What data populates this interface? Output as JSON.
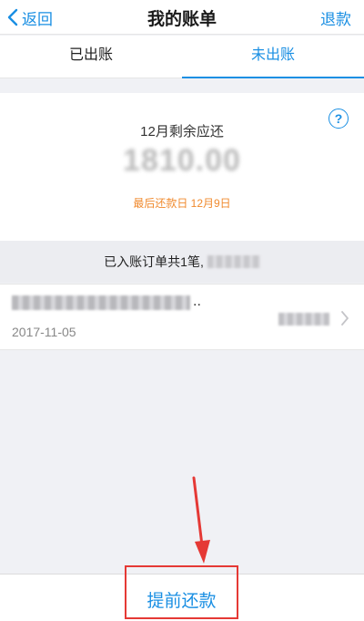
{
  "nav": {
    "back_label": "返回",
    "title": "我的账单",
    "right_label": "退款"
  },
  "tabs": [
    {
      "label": "已出账",
      "active": false
    },
    {
      "label": "未出账",
      "active": true
    }
  ],
  "summary": {
    "label": "12月剩余应还",
    "amount": "1810.00",
    "due_text": "最后还款日 12月9日",
    "help_icon": "?"
  },
  "orders": {
    "count_text": "已入账订单共1笔,",
    "items": [
      {
        "name_suffix": "..",
        "date": "2017-11-05"
      }
    ]
  },
  "bottom": {
    "repay_label": "提前还款"
  },
  "colors": {
    "accent": "#1a8fe3",
    "warning": "#f08a2e",
    "annotation": "#e53935"
  },
  "icons": {
    "back": "chevron-left-icon",
    "help": "question-circle-icon",
    "row": "chevron-right-icon",
    "annotation": "red-arrow-icon"
  }
}
